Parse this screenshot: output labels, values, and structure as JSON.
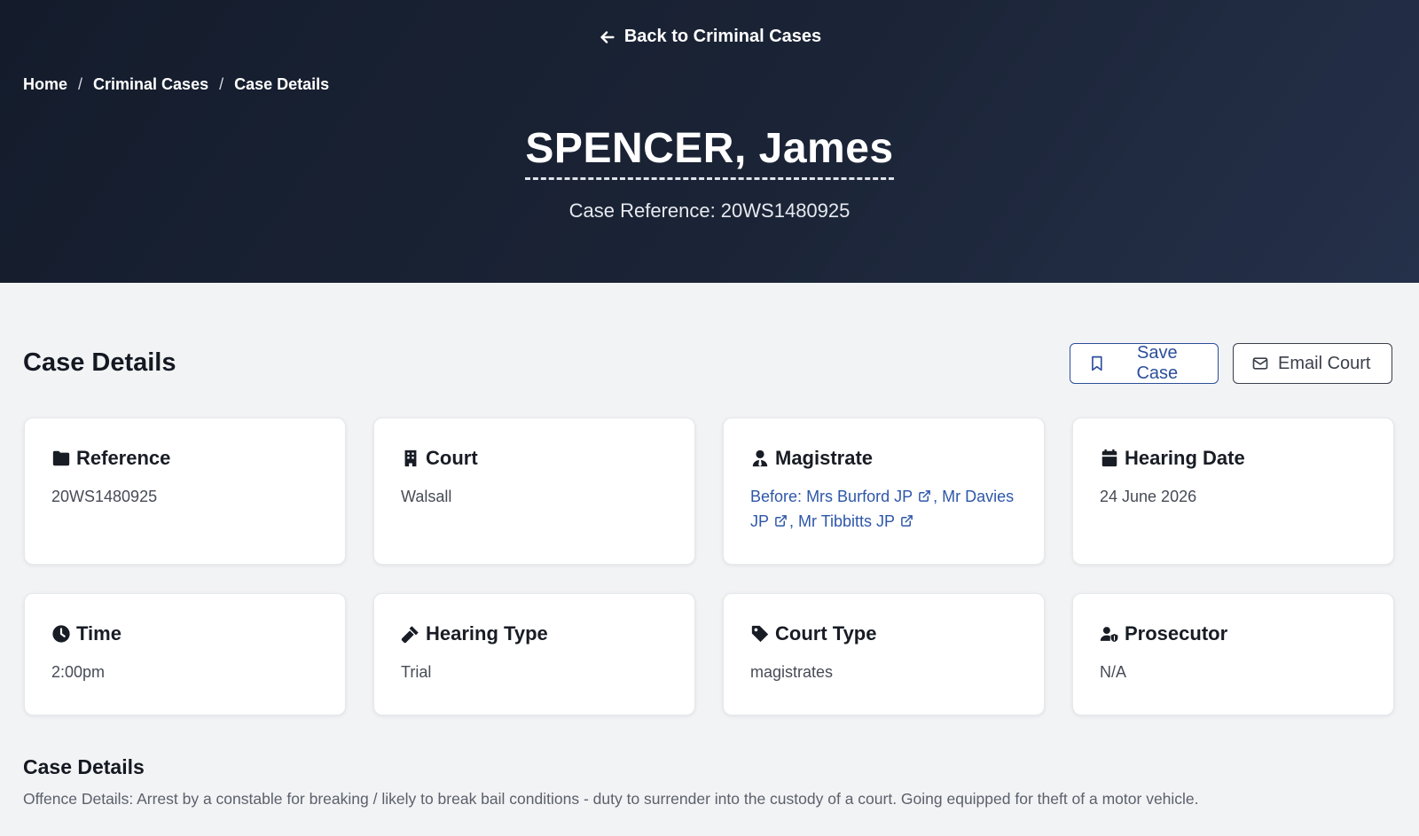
{
  "header": {
    "back_link": "Back to Criminal Cases",
    "breadcrumb": [
      "Home",
      "Criminal Cases",
      "Case Details"
    ],
    "breadcrumb_separator": "/",
    "title": "SPENCER, James",
    "case_reference": "Case Reference: 20WS1480925"
  },
  "main": {
    "section_title": "Case Details",
    "save_button": "Save Case",
    "email_button": "Email Court",
    "cards": {
      "reference": {
        "title": "Reference",
        "value": "20WS1480925",
        "icon": "folder-icon"
      },
      "court": {
        "title": "Court",
        "value": "Walsall",
        "icon": "building-icon"
      },
      "magistrate": {
        "title": "Magistrate",
        "icon": "user-tie-icon",
        "prefix": "Before:",
        "names": [
          "Mrs Burford JP",
          "Mr Davies JP",
          "Mr Tibbitts JP"
        ],
        "separator": ","
      },
      "hearing_date": {
        "title": "Hearing Date",
        "value": "24 June 2026",
        "icon": "calendar-icon"
      },
      "time": {
        "title": "Time",
        "value": "2:00pm",
        "icon": "clock-icon"
      },
      "hearing_type": {
        "title": "Hearing Type",
        "value": "Trial",
        "icon": "gavel-icon"
      },
      "court_type": {
        "title": "Court Type",
        "value": "magistrates",
        "icon": "tag-icon"
      },
      "prosecutor": {
        "title": "Prosecutor",
        "value": "N/A",
        "icon": "user-shield-icon"
      }
    },
    "details": {
      "title": "Case Details",
      "text": "Offence Details: Arrest by a constable for breaking / likely to break bail conditions - duty to surrender into the custody of a court. Going equipped for theft of a motor vehicle."
    }
  },
  "colors": {
    "hero_bg": "#1b2436",
    "link_blue": "#2e57a8",
    "save_border": "#2c4f9a",
    "page_bg": "#f2f3f5"
  }
}
